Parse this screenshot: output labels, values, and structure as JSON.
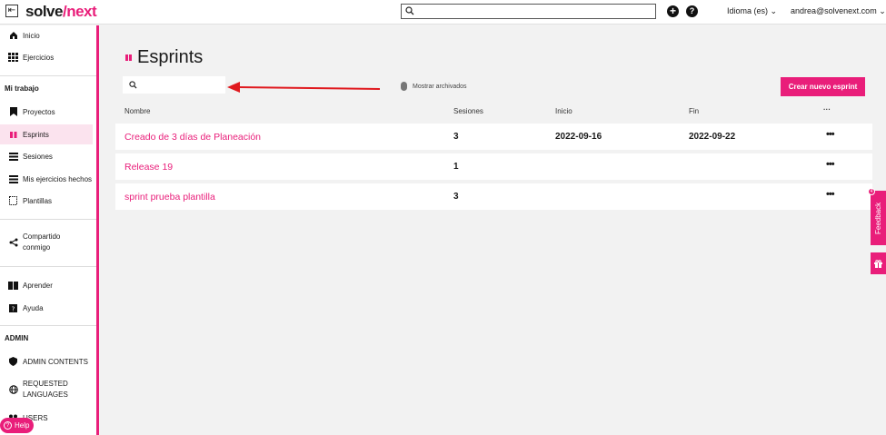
{
  "header": {
    "back_glyph": "⇤",
    "logo_part1": "solve",
    "logo_part2": "/next",
    "lang": "Idioma (es)",
    "user": "andrea@solvenext.com"
  },
  "sidebar": {
    "top_items": [
      {
        "label": "Inicio",
        "icon": "home-icon"
      },
      {
        "label": "Ejercicios",
        "icon": "grid-icon"
      }
    ],
    "section_mi_trabajo": "Mi trabajo",
    "work_items": [
      {
        "label": "Proyectos",
        "icon": "bookmark-icon"
      },
      {
        "label": "Esprints",
        "icon": "sprint-icon",
        "active": true
      },
      {
        "label": "Sesiones",
        "icon": "list-icon"
      },
      {
        "label": "Mis ejercicios hechos",
        "icon": "list-icon"
      },
      {
        "label": "Plantillas",
        "icon": "template-icon"
      }
    ],
    "shared": {
      "label_line1": "Compartido",
      "label_line2": "conmigo",
      "icon": "share-icon"
    },
    "learn_items": [
      {
        "label": "Aprender",
        "icon": "book-icon"
      },
      {
        "label": "Ayuda",
        "icon": "help-icon"
      }
    ],
    "section_admin": "ADMIN",
    "admin_items": [
      {
        "label": "ADMIN CONTENTS",
        "icon": "shield-icon"
      },
      {
        "label_line1": "REQUESTED",
        "label_line2": "LANGUAGES",
        "icon": "globe-icon"
      },
      {
        "label": "USERS",
        "icon": "users-icon"
      }
    ],
    "help_pill": "Help"
  },
  "main": {
    "title": "Esprints",
    "search_placeholder": "",
    "archived_label": "Mostrar archivados",
    "create_button": "Crear nuevo esprint",
    "columns": {
      "name": "Nombre",
      "sessions": "Sesiones",
      "start": "Inicio",
      "end": "Fin",
      "more": "···"
    },
    "rows": [
      {
        "name": "Creado de 3 días de Planeación",
        "sessions": "3",
        "start": "2022-09-16",
        "end": "2022-09-22",
        "more": "•••"
      },
      {
        "name": "Release 19",
        "sessions": "1",
        "start": "",
        "end": "",
        "more": "•••"
      },
      {
        "name": "sprint prueba plantilla",
        "sessions": "3",
        "start": "",
        "end": "",
        "more": "•••"
      }
    ]
  },
  "widgets": {
    "feedback_label": "Feedback",
    "feedback_badge": "4"
  },
  "colors": {
    "brand": "#e91e7a",
    "arrow": "#e0191e"
  }
}
